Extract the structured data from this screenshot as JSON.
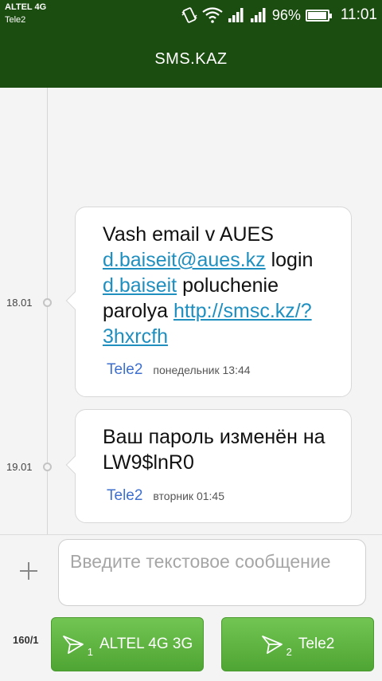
{
  "statusbar": {
    "carrier_primary": "ALTEL 4G",
    "carrier_secondary": "Tele2",
    "battery_percent": "96%",
    "battery_level": 0.96,
    "time": "11:01",
    "icons": [
      "vibrate-icon",
      "wifi-icon",
      "signal-icon",
      "signal-icon",
      "battery-icon"
    ]
  },
  "header": {
    "title": "SMS.KAZ"
  },
  "thread": {
    "messages": [
      {
        "date": "18.01",
        "text_parts": [
          {
            "type": "text",
            "value": "Vash email v AUES "
          },
          {
            "type": "link",
            "value": "d.baiseit@aues.kz"
          },
          {
            "type": "text",
            "value": " login "
          },
          {
            "type": "link",
            "value": "d.baiseit"
          },
          {
            "type": "text",
            "value": " poluchenie parolya "
          },
          {
            "type": "link",
            "value": "http://smsc.kz/?3hxrcfh"
          }
        ],
        "sim": "Tele2",
        "time": "понедельник 13:44"
      },
      {
        "date": "19.01",
        "text_parts": [
          {
            "type": "text",
            "value": "Ваш пароль изменён на    LW9$lnR0"
          }
        ],
        "sim": "Tele2",
        "time": "вторник 01:45"
      }
    ]
  },
  "composer": {
    "placeholder": "Введите текстовое сообщение",
    "counter": "160/1",
    "send_buttons": [
      {
        "sim_number": "1",
        "label": "ALTEL 4G 3G"
      },
      {
        "sim_number": "2",
        "label": "Tele2"
      }
    ]
  },
  "colors": {
    "header_bg": "#1c4d10",
    "send_button": "#5cb23d",
    "link": "#1f8fc0",
    "sim_label": "#3d6fcf"
  }
}
